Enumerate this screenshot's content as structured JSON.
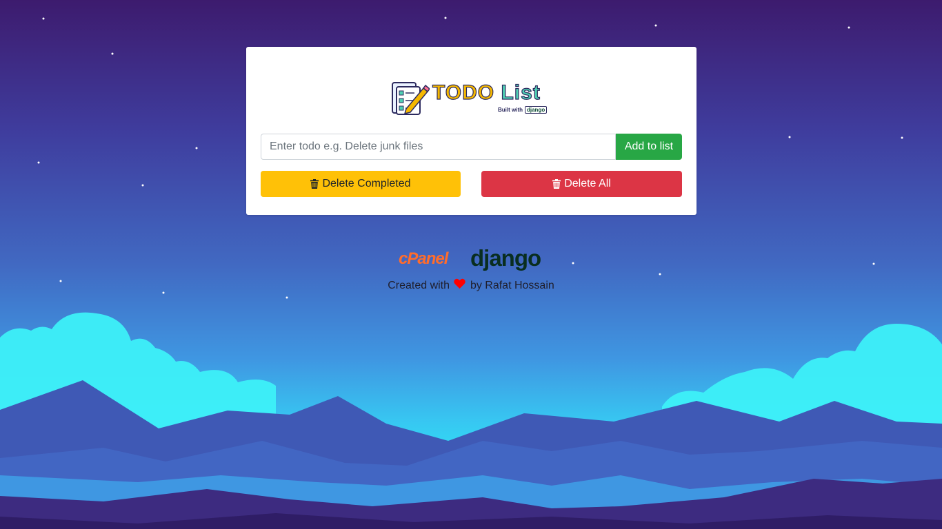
{
  "logo": {
    "title_part1": "TODO",
    "title_part2": "List",
    "built_with": "Built with",
    "framework_badge": "django"
  },
  "form": {
    "input_placeholder": "Enter todo e.g. Delete junk files",
    "input_value": "",
    "add_button": "Add to list",
    "delete_completed_button": "Delete Completed",
    "delete_all_button": "Delete All"
  },
  "footer": {
    "brand_cpanel": "cPanel",
    "brand_django": "django",
    "created_with": "Created with",
    "by_text": "by Rafat Hossain"
  },
  "icons": {
    "logo_icon": "clipboard-checklist-pencil-icon",
    "delete_icon": "trash-icon",
    "heart_icon": "heart-icon"
  },
  "colors": {
    "add_button": "#28a745",
    "delete_completed_button": "#ffc107",
    "delete_all_button": "#dc3545",
    "heart": "#ff0000",
    "cpanel_brand": "#ff6c2c",
    "django_brand": "#092e20"
  }
}
